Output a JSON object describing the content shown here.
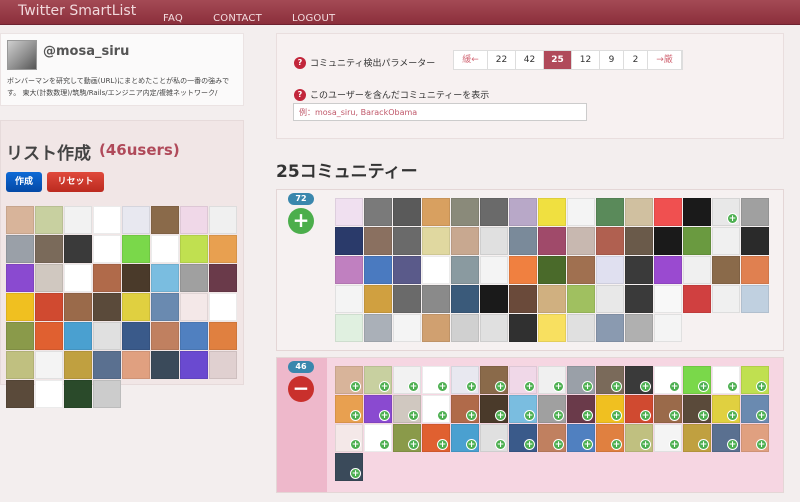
{
  "nav": {
    "brand": "Twitter SmartList",
    "links": [
      {
        "label": "FAQ",
        "name": "nav-faq"
      },
      {
        "label": "CONTACT",
        "name": "nav-contact"
      },
      {
        "label": "LOGOUT",
        "name": "nav-logout"
      }
    ]
  },
  "profile": {
    "handle": "@mosa_siru",
    "bio": "ボンバーマンを研究して動画(URL)にまとめたことが私の一番の強みです。 東大(計数数理)/筑駒/Rails/エンジニア内定/複雑ネットワーク/"
  },
  "list": {
    "title": "リスト作成",
    "count": "(46users)",
    "create_label": "作成",
    "reset_label": "リセット",
    "thumb_colors": [
      "#d8b49a",
      "#c8d0a0",
      "#f2f2f2",
      "#ffffff",
      "#e8e8f0",
      "#8a6a4a",
      "#f0d8e8",
      "#f0f0f0",
      "#9aa0a8",
      "#7a6a5a",
      "#3a3a3a",
      "#ffffff",
      "#7ad84a",
      "#ffffff",
      "#c0e050",
      "#e8a050",
      "#8a4ad0",
      "#d0c8c0",
      "#ffffff",
      "#b06a4a",
      "#4a3a2a",
      "#7abde0",
      "#a0a0a0",
      "#6a3a4a",
      "#f0c020",
      "#d04a30",
      "#9a6a4a",
      "#5a4a3a",
      "#e0d040",
      "#6a8ab0",
      "#f4e8e8",
      "#ffffff",
      "#8a9a4a",
      "#e06030",
      "#4aa0d0",
      "#e0e0e0",
      "#3a5a8a",
      "#c08060",
      "#5080c0",
      "#e08040",
      "#c0c080",
      "#f4f4f4",
      "#c0a040",
      "#5a7090",
      "#e0a080",
      "#3a4a5a",
      "#6a4ad0",
      "#e0d0d0",
      "#5a4a3a",
      "#ffffff",
      "#2a4a2a",
      "#cccccc"
    ]
  },
  "params": {
    "label": "コミュニティ検出パラメーター",
    "pager": [
      {
        "label": "緩←",
        "type": "nav"
      },
      {
        "label": "22",
        "type": "page"
      },
      {
        "label": "42",
        "type": "page"
      },
      {
        "label": "25",
        "type": "active"
      },
      {
        "label": "12",
        "type": "page"
      },
      {
        "label": "9",
        "type": "page"
      },
      {
        "label": "2",
        "type": "page"
      },
      {
        "label": "→厳",
        "type": "nav"
      }
    ],
    "show_label": "このユーザーを含んだコミュニティーを表示",
    "example_placeholder": "例：mosa_siru, BarackObama"
  },
  "section_title": "25コミュニティー",
  "communities": [
    {
      "count": "72",
      "action": "+",
      "bg": "#f6f1f1",
      "side_bg": "#f6f1f1",
      "btn_color": "#4cae4c",
      "thumb_colors": [
        "#f0e0f0",
        "#7a7a7a",
        "#5a5a5a",
        "#d8a060",
        "#8a8a7a",
        "#6a6a6a",
        "#b8a8c8",
        "#f0e040",
        "#f4f4f4",
        "#5a8a5a",
        "#d0c0a0",
        "#f05050",
        "#1a1a1a",
        "#e8e8e8",
        "#a0a0a0",
        "#2a3a6a",
        "#8a7060",
        "#6a6a6a",
        "#e0d8a0",
        "#c8a890",
        "#e0e0e0",
        "#7a8a9a",
        "#a04a6a",
        "#c8b8b0",
        "#b06050",
        "#6a5a4a",
        "#1a1a1a",
        "#6a9a40",
        "#f0f0f0",
        "#2a2a2a",
        "#c080c0",
        "#4a7ac0",
        "#5a5a8a",
        "#ffffff",
        "#8a9aa0",
        "#f4f4f4",
        "#f08040",
        "#4a6a2a",
        "#a07050",
        "#e0e0f0",
        "#3a3a3a",
        "#9a4ad0",
        "#f0f0f0",
        "#8a6a4a",
        "#e08050",
        "#f4f4f4",
        "#d0a040",
        "#6a6a6a",
        "#8a8a8a",
        "#3a5a7a",
        "#1a1a1a",
        "#6a4a3a",
        "#d0b080",
        "#a0c060",
        "#e8e8e8",
        "#3a3a3a",
        "#f8f8f8",
        "#d04040",
        "#f0f0f0",
        "#c0d0e0",
        "#e0f0e0",
        "#aab0b8",
        "#f4f4f4",
        "#d0a070",
        "#d0d0d0",
        "#e0e0e0",
        "#303030",
        "#f8e060",
        "#e0e0e0",
        "#8a9ab0",
        "#b0b0b0",
        "#f4f4f4"
      ],
      "marks": [
        13
      ]
    },
    {
      "count": "46",
      "action": "−",
      "bg": "#f6d6e2",
      "side_bg": "#eeb8cb",
      "btn_color": "#c9302c",
      "thumb_colors": [
        "#d8b49a",
        "#c8d0a0",
        "#f2f2f2",
        "#ffffff",
        "#e8e8f0",
        "#8a6a4a",
        "#f0d8e8",
        "#f0f0f0",
        "#9aa0a8",
        "#7a6a5a",
        "#3a3a3a",
        "#ffffff",
        "#7ad84a",
        "#ffffff",
        "#c0e050",
        "#e8a050",
        "#8a4ad0",
        "#d0c8c0",
        "#ffffff",
        "#b06a4a",
        "#4a3a2a",
        "#7abde0",
        "#a0a0a0",
        "#6a3a4a",
        "#f0c020",
        "#d04a30",
        "#9a6a4a",
        "#5a4a3a",
        "#e0d040",
        "#6a8ab0",
        "#f4e8e8",
        "#ffffff",
        "#8a9a4a",
        "#e06030",
        "#4aa0d0",
        "#e0e0e0",
        "#3a5a8a",
        "#c08060",
        "#5080c0",
        "#e08040",
        "#c0c080",
        "#f4f4f4",
        "#c0a040",
        "#5a7090",
        "#e0a080",
        "#3a4a5a"
      ],
      "marks": [
        0,
        1,
        2,
        3,
        4,
        5,
        6,
        7,
        8,
        9,
        10,
        11,
        12,
        13,
        14,
        15,
        16,
        17,
        18,
        19,
        20,
        21,
        22,
        23,
        24,
        25,
        26,
        27,
        28,
        29,
        30,
        31,
        32,
        33,
        34,
        35,
        36,
        37,
        38,
        39,
        40,
        41,
        42,
        43,
        44,
        45
      ]
    }
  ]
}
